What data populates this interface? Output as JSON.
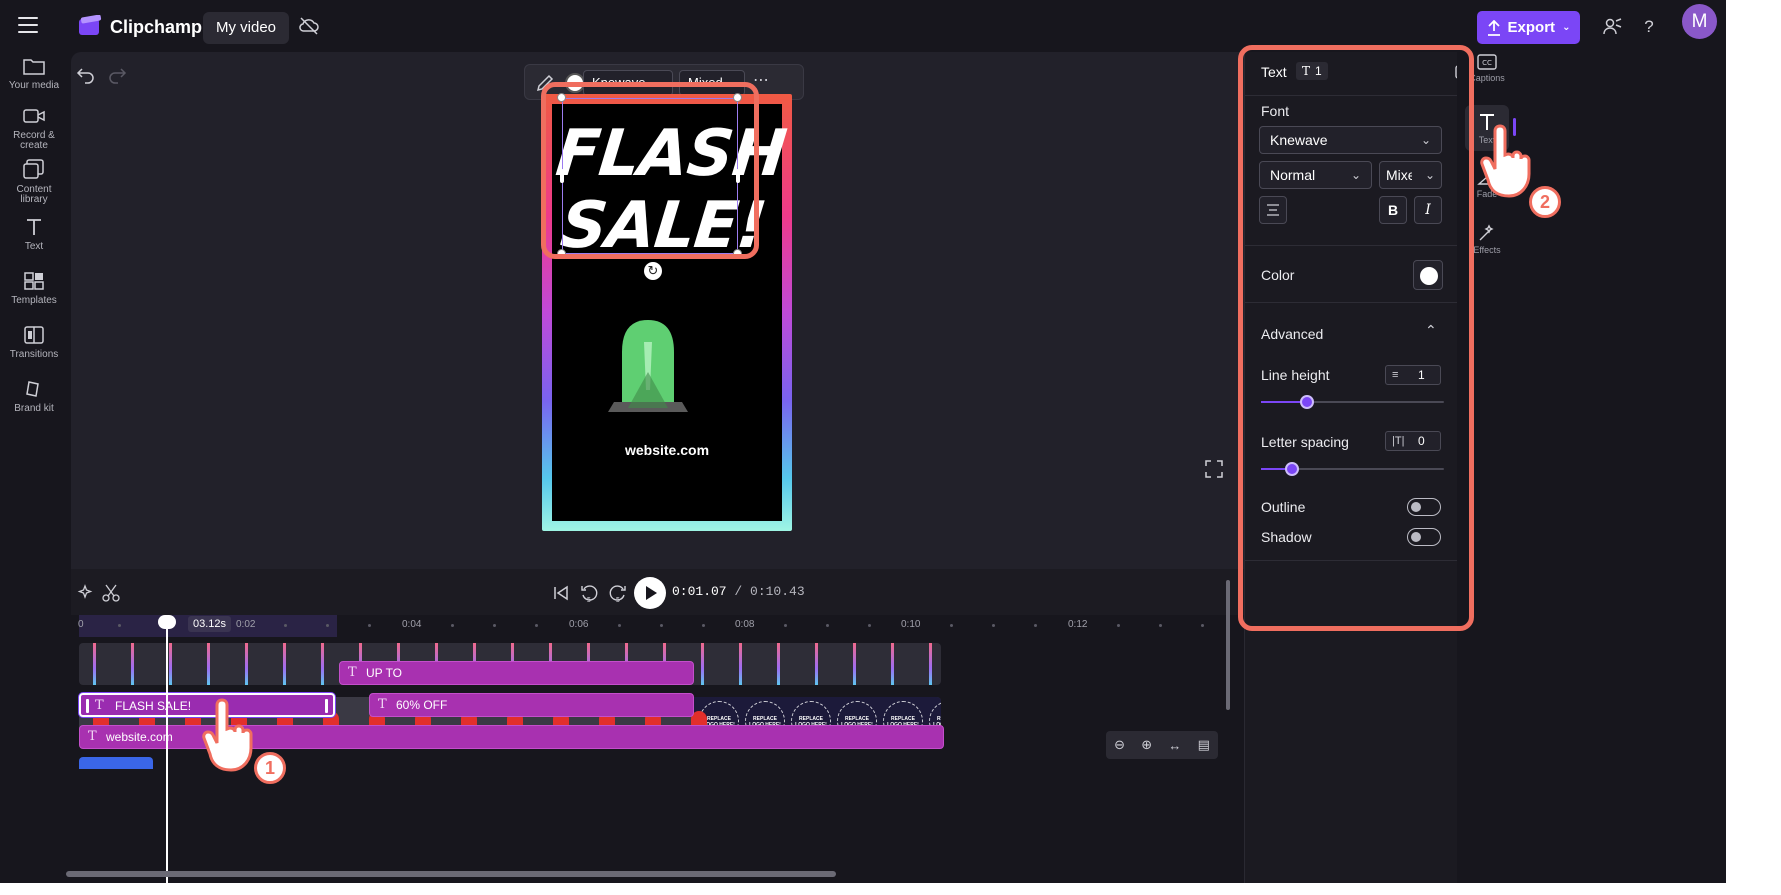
{
  "topbar": {
    "brand": "Clipchamp",
    "project_name": "My video",
    "export_label": "Export",
    "avatar_initial": "M",
    "accent_color": "#7b46f6"
  },
  "leftrail": {
    "items": [
      {
        "label": "Your media",
        "icon": "folder-icon"
      },
      {
        "label": "Record & create",
        "icon": "camera-icon"
      },
      {
        "label": "Content library",
        "icon": "library-icon"
      },
      {
        "label": "Text",
        "icon": "text-icon"
      },
      {
        "label": "Templates",
        "icon": "templates-icon"
      },
      {
        "label": "Transitions",
        "icon": "transitions-icon"
      },
      {
        "label": "Brand kit",
        "icon": "brand-kit-icon"
      }
    ]
  },
  "text_toolbar": {
    "font": "Knewave",
    "style": "Mixed"
  },
  "preview": {
    "headline_line1": "FLASH",
    "headline_line2": "SALE!",
    "footer": "website.com"
  },
  "player": {
    "current_time": "0:01.07",
    "duration": "/ 0:10.43"
  },
  "timeline": {
    "playhead_time": "03.12s",
    "ruler_labels": [
      "0",
      "0:02",
      "0:04",
      "0:06",
      "0:08",
      "0:10",
      "0:12"
    ],
    "replace_logo_text": "REPLACE LOGO HERE!",
    "text_clips": [
      {
        "label": "UP TO"
      },
      {
        "label": "FLASH SALE!"
      },
      {
        "label": "60% OFF"
      },
      {
        "label": "website.com"
      }
    ]
  },
  "panel": {
    "title": "Text",
    "count": "1",
    "font_label": "Font",
    "font_value": "Knewave",
    "weight_value": "Normal",
    "style_value": "Mixed",
    "bold": "B",
    "italic": "I",
    "color_label": "Color",
    "advanced_label": "Advanced",
    "line_height_label": "Line height",
    "line_height_value": "1",
    "line_height_level": 0.25,
    "letter_spacing_label": "Letter spacing",
    "letter_spacing_value": "0",
    "letter_spacing_level": 0.17,
    "outline_label": "Outline",
    "outline_on": false,
    "shadow_label": "Shadow",
    "shadow_on": false
  },
  "rightrail": {
    "items": [
      {
        "label": "Captions",
        "icon": "captions-icon"
      },
      {
        "label": "Text",
        "icon": "text-icon"
      },
      {
        "label": "Fade",
        "icon": "fade-icon"
      },
      {
        "label": "Effects",
        "icon": "effects-icon"
      }
    ]
  },
  "callouts": {
    "step1": "1",
    "step2": "2",
    "highlight_color": "#f06e5f"
  }
}
